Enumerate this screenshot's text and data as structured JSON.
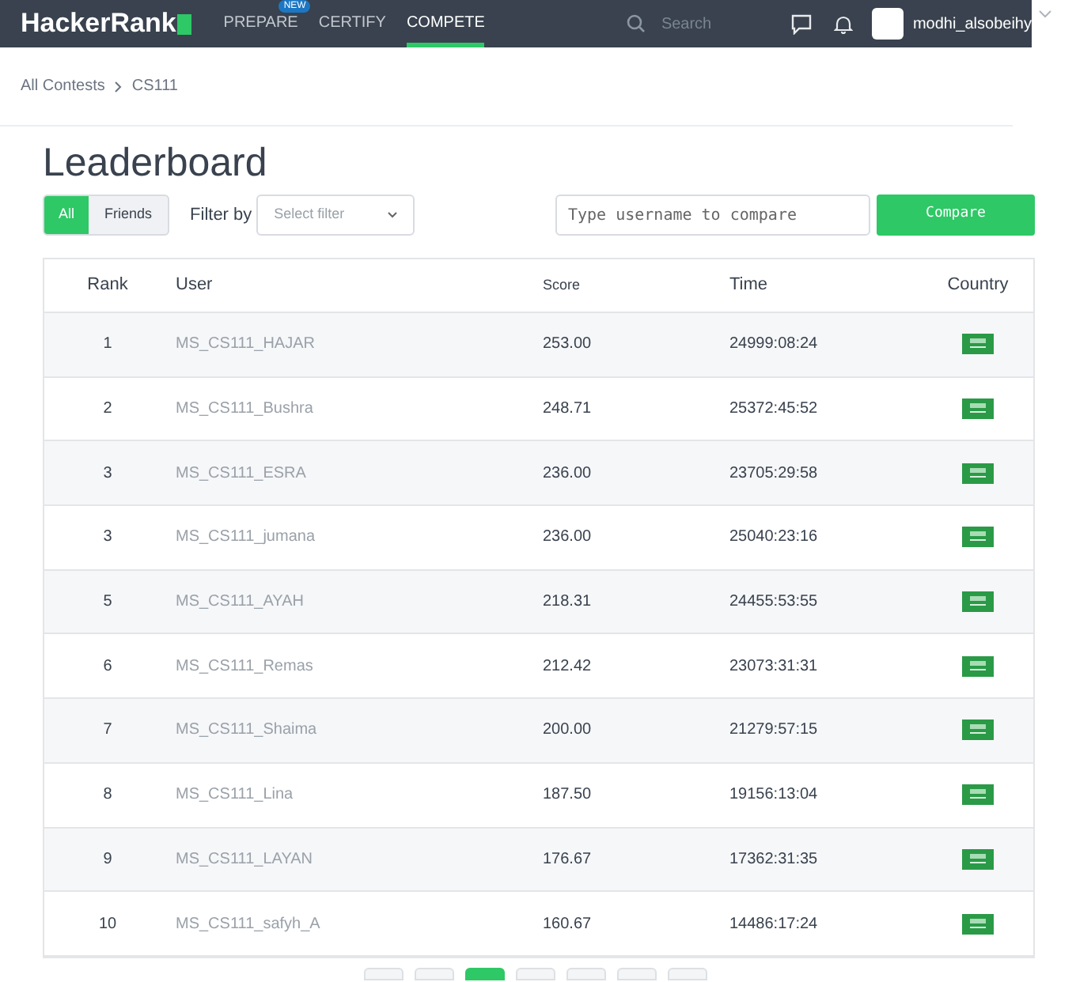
{
  "nav": {
    "logo": "HackerRank",
    "items": [
      {
        "label": "PREPARE",
        "badge": "NEW",
        "selected": false
      },
      {
        "label": "CERTIFY",
        "selected": false
      },
      {
        "label": "COMPETE",
        "selected": true
      }
    ],
    "search": {
      "placeholder": "Search"
    },
    "username": "modhi_alsobeihy"
  },
  "breadcrumb": [
    "All Contests",
    "CS111"
  ],
  "title": "Leaderboard",
  "toggle": [
    {
      "label": "All",
      "selected": true
    },
    {
      "label": "Friends",
      "selected": false
    }
  ],
  "filter": {
    "label": "Filter by",
    "placeholder": "Select filter"
  },
  "compare": {
    "placeholder": "Type username to compare",
    "button": "Compare"
  },
  "table": {
    "columns": [
      "Rank",
      "User",
      "Score",
      "Time",
      "Country"
    ],
    "rows": [
      {
        "rank": "1",
        "user": "MS_CS111_HAJAR",
        "score": "253.00",
        "time": "24999:08:24"
      },
      {
        "rank": "2",
        "user": "MS_CS111_Bushra",
        "score": "248.71",
        "time": "25372:45:52"
      },
      {
        "rank": "3",
        "user": "MS_CS111_ESRA",
        "score": "236.00",
        "time": "23705:29:58"
      },
      {
        "rank": "3",
        "user": "MS_CS111_jumana",
        "score": "236.00",
        "time": "25040:23:16"
      },
      {
        "rank": "5",
        "user": "MS_CS111_AYAH",
        "score": "218.31",
        "time": "24455:53:55"
      },
      {
        "rank": "6",
        "user": "MS_CS111_Remas",
        "score": "212.42",
        "time": "23073:31:31"
      },
      {
        "rank": "7",
        "user": "MS_CS111_Shaima",
        "score": "200.00",
        "time": "21279:57:15"
      },
      {
        "rank": "8",
        "user": "MS_CS111_Lina",
        "score": "187.50",
        "time": "19156:13:04"
      },
      {
        "rank": "9",
        "user": "MS_CS111_LAYAN",
        "score": "176.67",
        "time": "17362:31:35"
      },
      {
        "rank": "10",
        "user": "MS_CS111_safyh_A",
        "score": "160.67",
        "time": "14486:17:24"
      }
    ]
  },
  "pagination": [
    {
      "selected": false
    },
    {
      "selected": false
    },
    {
      "selected": true
    },
    {
      "selected": false
    },
    {
      "selected": false
    },
    {
      "selected": false
    },
    {
      "selected": false
    }
  ]
}
